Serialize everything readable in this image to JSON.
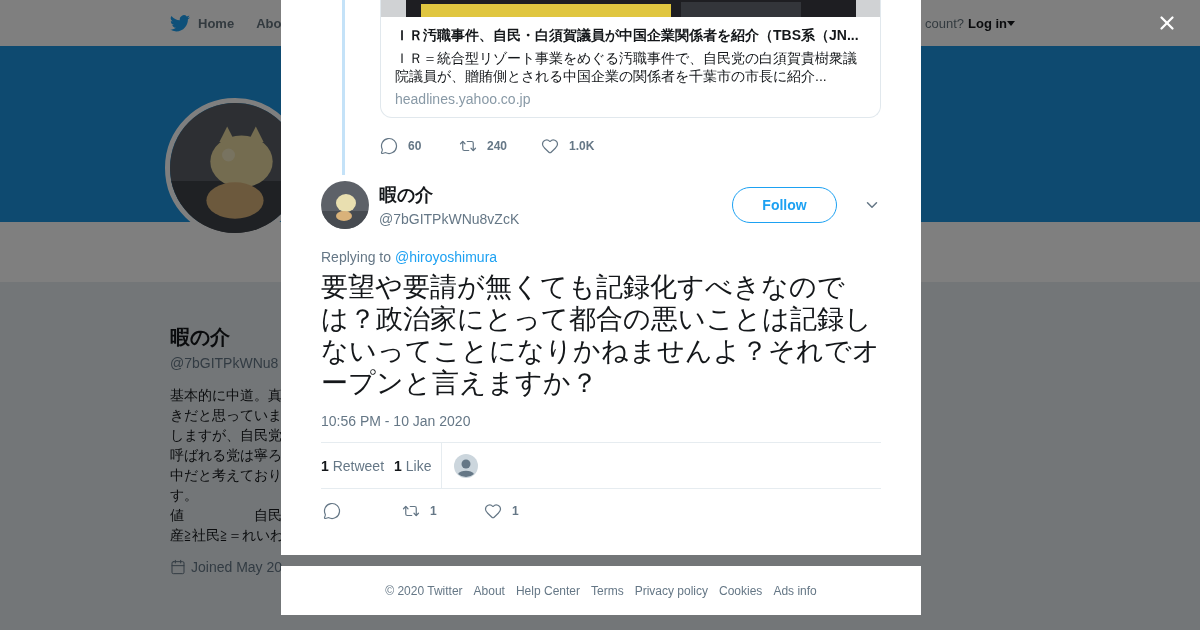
{
  "nav": {
    "items": [
      "Home",
      "Abo"
    ],
    "account_prompt": "count?",
    "login": "Log in"
  },
  "profile": {
    "name": "暇の介",
    "handle": "@7bGITPkWNu8",
    "bio_lines": [
      "基本的に中道。真",
      "きだと思っていま",
      "しますが、自民党",
      "呼ばれる党は寧ろ",
      "中だと考えており",
      "す。",
      "値　　　　　自民",
      "産≧社民≧＝れいわ"
    ],
    "joined": "Joined May 20"
  },
  "modal": {
    "link_card": {
      "title": "ＩＲ汚職事件、自民・白須賀議員が中国企業関係者を紹介（TBS系（JN...",
      "description": "ＩＲ＝統合型リゾート事業をめぐる汚職事件で、自民党の白須賀貴樹衆議院議員が、贈賄側とされる中国企業の関係者を千葉市の市長に紹介...",
      "domain": "headlines.yahoo.co.jp"
    },
    "parent_actions": [
      {
        "kind": "reply",
        "count": "60"
      },
      {
        "kind": "retweet",
        "count": "240"
      },
      {
        "kind": "like",
        "count": "1.0K"
      }
    ],
    "tweet": {
      "name": "暇の介",
      "handle": "@7bGITPkWNu8vZcK",
      "follow": "Follow",
      "replying_prefix": "Replying to",
      "replying_to": "@hiroyoshimura",
      "text": "要望や要請が無くても記録化すべきなのでは？政治家にとって都合の悪いことは記録しないってことになりかねませんよ？それでオープンと言えますか？",
      "time": "10:56 PM - 10 Jan 2020",
      "stats": [
        {
          "count": "1",
          "label": "Retweet"
        },
        {
          "count": "1",
          "label": "Like"
        }
      ],
      "actions": [
        {
          "kind": "reply"
        },
        {
          "kind": "retweet",
          "count": "1"
        },
        {
          "kind": "like",
          "count": "1"
        }
      ]
    }
  },
  "footer": [
    "© 2020 Twitter",
    "About",
    "Help Center",
    "Terms",
    "Privacy policy",
    "Cookies",
    "Ads info"
  ]
}
